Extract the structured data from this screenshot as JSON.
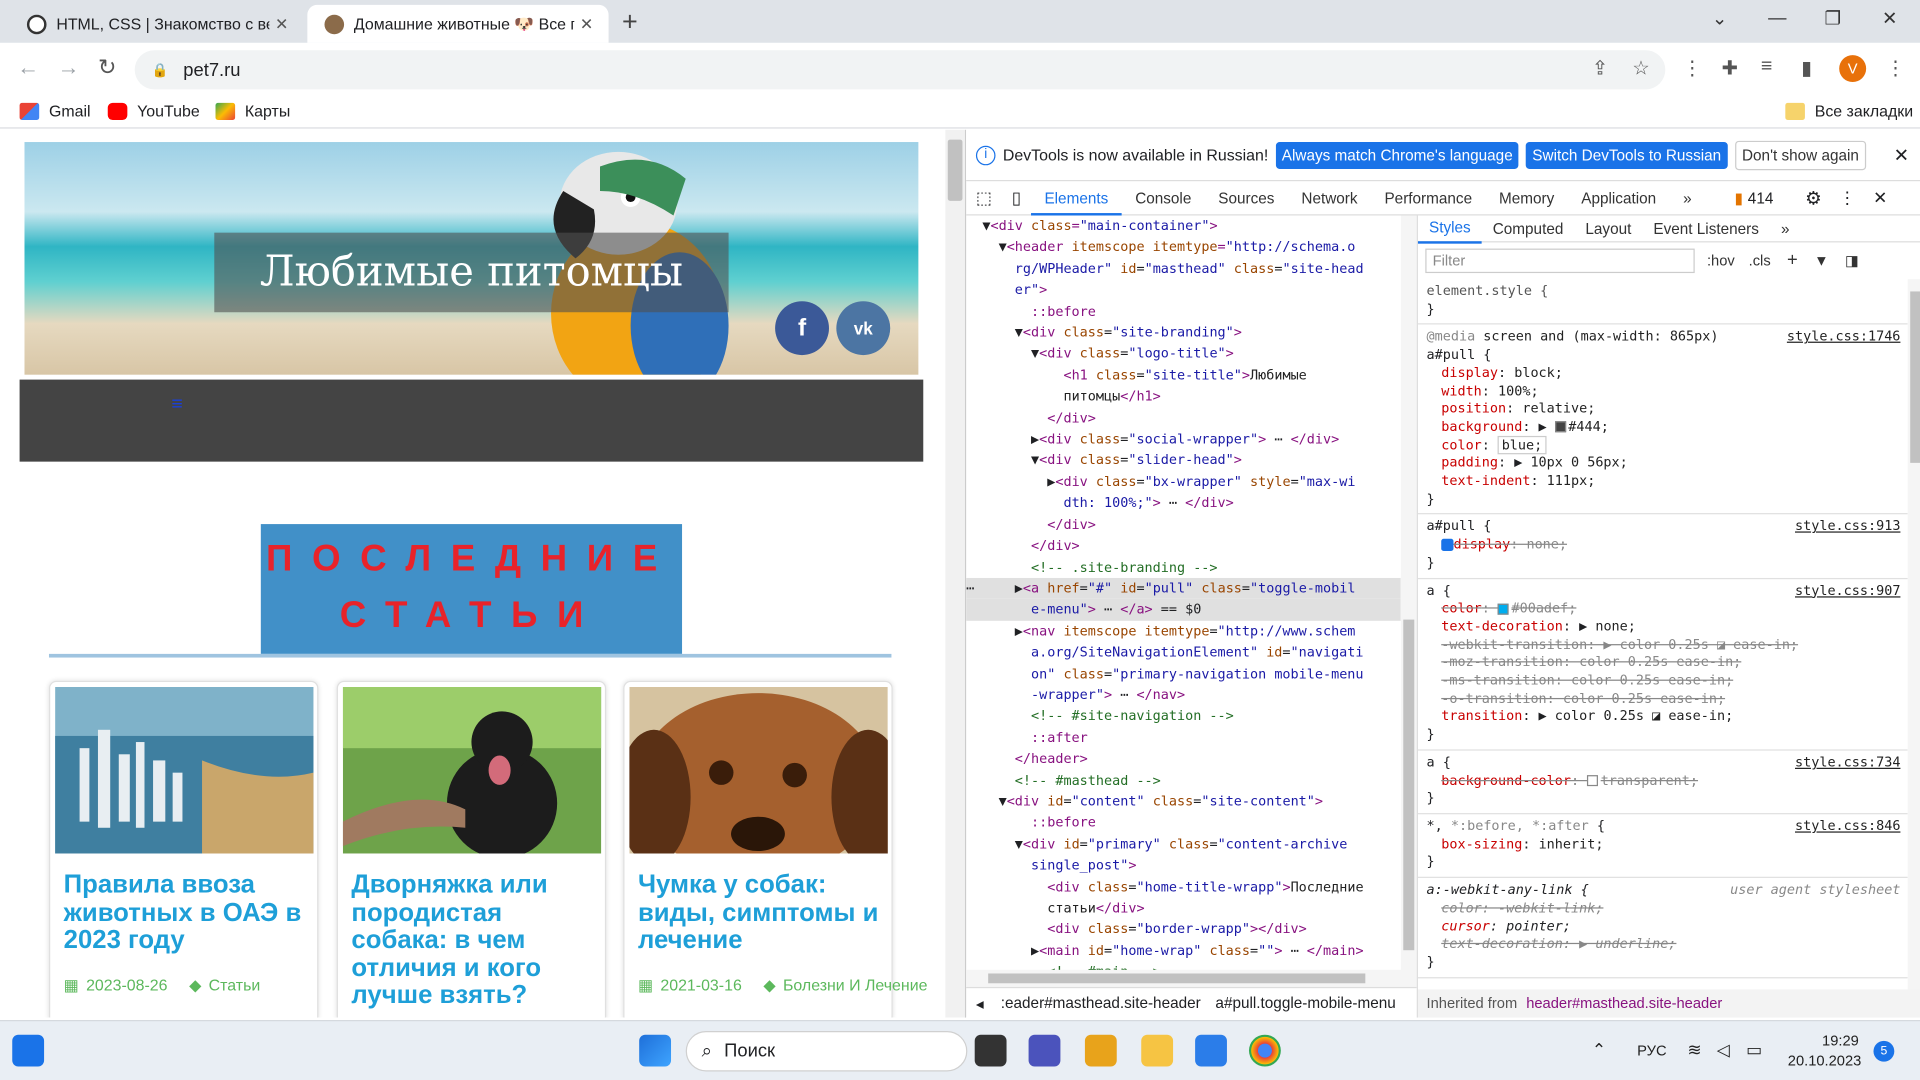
{
  "browser": {
    "tabs": [
      {
        "label": "HTML, CSS | Знакомство с веб-",
        "close": "✕"
      },
      {
        "label": "Домашние животные 🐶 Все п",
        "close": "✕"
      }
    ],
    "new_tab": "+",
    "url": "pet7.ru",
    "avatar_letter": "V",
    "bookmarks": [
      "Gmail",
      "YouTube",
      "Карты"
    ],
    "all_bookmarks": "Все закладки"
  },
  "site": {
    "title": "Любимые питомцы",
    "social": [
      "f",
      "vk"
    ],
    "section_title": "ПОСЛЕДНИЕ СТАТЬИ",
    "cards": [
      {
        "title": "Правила ввоза животных в ОАЭ в 2023 году",
        "date": "2023-08-26",
        "category": "Статьи"
      },
      {
        "title": "Дворняжка или породистая собака: в чем отличия и кого лучше взять?",
        "date": "",
        "category": ""
      },
      {
        "title": "Чумка у собак: виды, симптомы и лечение",
        "date": "2021-03-16",
        "category": "Болезни И Лечение"
      }
    ]
  },
  "devtools": {
    "info": "DevTools is now available in Russian!",
    "btn_match": "Always match Chrome's language",
    "btn_switch": "Switch DevTools to Russian",
    "btn_dont": "Don't show again",
    "tabs": [
      "Elements",
      "Console",
      "Sources",
      "Network",
      "Performance",
      "Memory",
      "Application"
    ],
    "issues_count": "414",
    "style_tabs": [
      "Styles",
      "Computed",
      "Layout",
      "Event Listeners"
    ],
    "filter_placeholder": "Filter",
    "hov": ":hov",
    "cls": ".cls",
    "crumb1": ":eader#masthead.site-header",
    "crumb2": "a#pull.toggle-mobile-menu",
    "inherited_label": "Inherited from",
    "inherited_sel": "header#masthead.site-header"
  },
  "taskbar": {
    "search": "Поиск",
    "lang": "РУС",
    "time": "19:29",
    "date": "20.10.2023",
    "notif": "5"
  }
}
